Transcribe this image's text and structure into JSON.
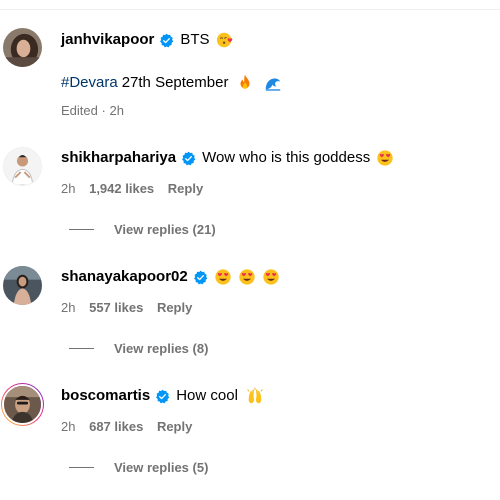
{
  "post": {
    "username": "janhvikapoor",
    "caption": "BTS",
    "caption_emoji": "kissing-face-heart-emoji",
    "hashtag": "#Devara",
    "caption_line2": "27th September",
    "line2_emojis": [
      "fire-emoji",
      "wave-emoji"
    ],
    "edited": "Edited",
    "separator": "·",
    "time": "2h"
  },
  "comments": [
    {
      "username": "shikharpahariya",
      "text": "Wow who is this goddess",
      "emojis": [
        "heart-eyes-emoji"
      ],
      "time": "2h",
      "likes": "1,942 likes",
      "reply": "Reply",
      "view_replies": "View replies (21)"
    },
    {
      "username": "shanayakapoor02",
      "text": "",
      "emojis": [
        "heart-eyes-emoji",
        "heart-eyes-emoji",
        "heart-eyes-emoji"
      ],
      "time": "2h",
      "likes": "557 likes",
      "reply": "Reply",
      "view_replies": "View replies (8)"
    },
    {
      "username": "boscomartis",
      "text": "How cool",
      "emojis": [
        "raising-hands-emoji"
      ],
      "time": "2h",
      "likes": "687 likes",
      "reply": "Reply",
      "view_replies": "View replies (5)"
    }
  ],
  "colors": {
    "verified": "#0095f6",
    "meta_gray": "#737373",
    "hashtag": "#00376b"
  }
}
